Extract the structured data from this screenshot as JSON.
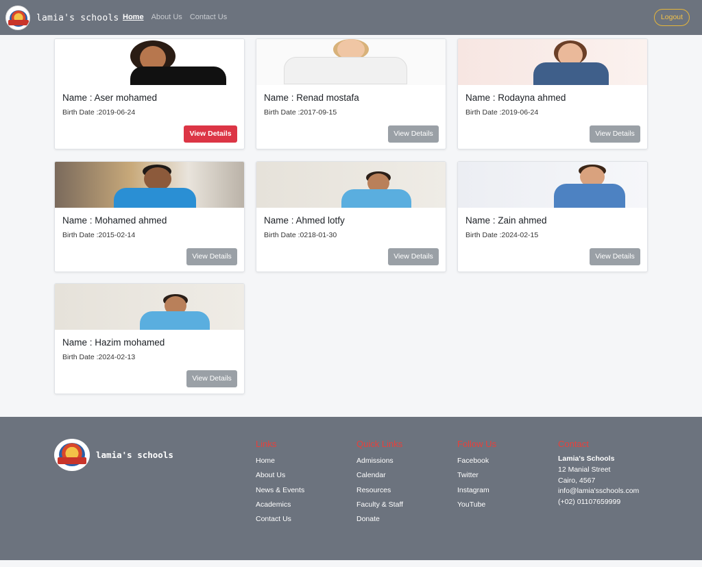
{
  "nav": {
    "brand": "lamia's schools",
    "links": [
      {
        "label": "Home",
        "active": true
      },
      {
        "label": "About Us",
        "active": false
      },
      {
        "label": "Contact Us",
        "active": false
      }
    ],
    "logout": "Logout"
  },
  "students": [
    {
      "name": "Name : Aser mohamed",
      "birth": "Birth Date :2019-06-24",
      "button": "View Details"
    },
    {
      "name": "Name : Renad mostafa",
      "birth": "Birth Date :2017-09-15",
      "button": "View Details"
    },
    {
      "name": "Name : Rodayna ahmed",
      "birth": "Birth Date :2019-06-24",
      "button": "View Details"
    },
    {
      "name": "Name : Mohamed ahmed",
      "birth": "Birth Date :2015-02-14",
      "button": "View Details"
    },
    {
      "name": "Name : Ahmed lotfy",
      "birth": "Birth Date :0218-01-30",
      "button": "View Details"
    },
    {
      "name": "Name : Zain ahmed",
      "birth": "Birth Date :2024-02-15",
      "button": "View Details"
    },
    {
      "name": "Name : Hazim mohamed",
      "birth": "Birth Date :2024-02-13",
      "button": "View Details"
    }
  ],
  "footer": {
    "brand": "lamia's schools",
    "links": {
      "title": "Links",
      "items": [
        "Home",
        "About Us",
        "News & Events",
        "Academics",
        "Contact Us"
      ]
    },
    "quick_links": {
      "title": "Quick Links",
      "items": [
        "Admissions",
        "Calendar",
        "Resources",
        "Faculty & Staff",
        "Donate"
      ]
    },
    "follow": {
      "title": "Follow Us",
      "items": [
        "Facebook",
        "Twitter",
        "Instagram",
        "YouTube"
      ]
    },
    "contact": {
      "title": "Contact",
      "org": "Lamia's Schools",
      "street": "12 Manial Street",
      "city": "Cairo, 4567",
      "email": "info@lamia'sschools.com",
      "phone": "(+02) 01107659999"
    }
  },
  "colors": {
    "navbar": "#6c737e",
    "accent_red": "#dc3545",
    "gold": "#e7b73a"
  }
}
